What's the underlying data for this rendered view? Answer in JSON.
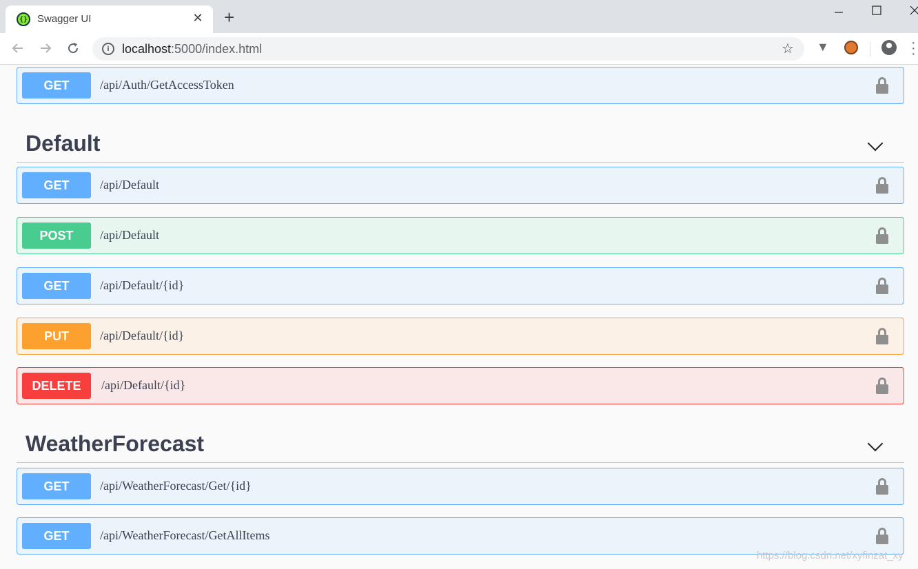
{
  "browser": {
    "tab_title": "Swagger UI",
    "tab_close": "✕",
    "new_tab": "+",
    "url_host": "localhost",
    "url_rest": ":5000/index.html"
  },
  "operations_top": [
    {
      "method": "GET",
      "path": "/api/Auth/GetAccessToken"
    }
  ],
  "sections": [
    {
      "title": "Default",
      "operations": [
        {
          "method": "GET",
          "path": "/api/Default"
        },
        {
          "method": "POST",
          "path": "/api/Default"
        },
        {
          "method": "GET",
          "path": "/api/Default/{id}"
        },
        {
          "method": "PUT",
          "path": "/api/Default/{id}"
        },
        {
          "method": "DELETE",
          "path": "/api/Default/{id}"
        }
      ]
    },
    {
      "title": "WeatherForecast",
      "operations": [
        {
          "method": "GET",
          "path": "/api/WeatherForecast/Get/{id}"
        },
        {
          "method": "GET",
          "path": "/api/WeatherForecast/GetAllItems"
        }
      ]
    }
  ],
  "watermark": "https://blog.csdn.net/xyfinzat_xy",
  "colors": {
    "get": "#61affe",
    "post": "#49cc90",
    "put": "#fca130",
    "delete": "#f93e3e"
  }
}
